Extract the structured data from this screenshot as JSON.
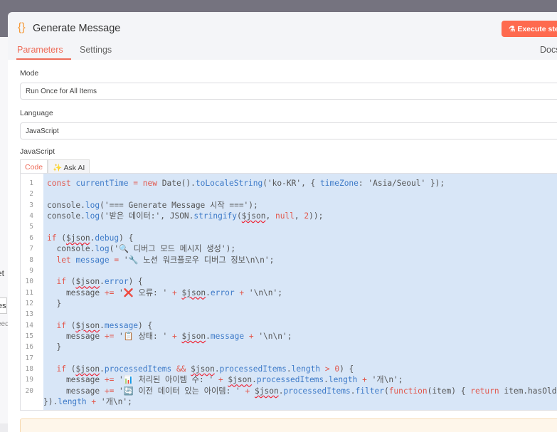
{
  "background_fragments": {
    "a": "et",
    "b": "es",
    "c": "eed"
  },
  "header": {
    "icon": "curly-braces-icon",
    "title": "Generate Message",
    "execute_label": "Execute step",
    "execute_icon": "flask-icon",
    "docs_label": "Docs"
  },
  "tabs": [
    {
      "label": "Parameters",
      "active": true
    },
    {
      "label": "Settings",
      "active": false
    }
  ],
  "fields": {
    "mode": {
      "label": "Mode",
      "value": "Run Once for All Items"
    },
    "language": {
      "label": "Language",
      "value": "JavaScript"
    },
    "code_label": "JavaScript"
  },
  "code_tabs": [
    {
      "label": "Code",
      "active": true
    },
    {
      "label": "Ask AI",
      "icon": "sparkle-icon"
    }
  ],
  "colors": {
    "accent": "#fe6a4f",
    "keyword": "#e2574c",
    "identifier": "#3d7ac8",
    "selection": "#d8e6f7"
  },
  "code_lines": [
    {
      "n": "1",
      "t": [
        [
          "k",
          "const"
        ],
        [
          "p",
          " "
        ],
        [
          "v",
          "currentTime"
        ],
        [
          "p",
          " "
        ],
        [
          "k",
          "="
        ],
        [
          "p",
          " "
        ],
        [
          "k",
          "new"
        ],
        [
          "p",
          " Date()."
        ],
        [
          "v",
          "toLocaleString"
        ],
        [
          "p",
          "('ko-KR', { "
        ],
        [
          "v",
          "timeZone"
        ],
        [
          "p",
          ": 'Asia/Seoul' });"
        ]
      ]
    },
    {
      "n": "2",
      "t": []
    },
    {
      "n": "3",
      "t": [
        [
          "p",
          "console."
        ],
        [
          "v",
          "log"
        ],
        [
          "p",
          "('=== Generate Message 시작 ===');"
        ]
      ]
    },
    {
      "n": "4",
      "t": [
        [
          "p",
          "console."
        ],
        [
          "v",
          "log"
        ],
        [
          "p",
          "('받은 데이터:', JSON."
        ],
        [
          "v",
          "stringify"
        ],
        [
          "p",
          "("
        ],
        [
          "u",
          "$json"
        ],
        [
          "p",
          ", "
        ],
        [
          "k",
          "null"
        ],
        [
          "p",
          ", "
        ],
        [
          "k",
          "2"
        ],
        [
          "p",
          "));"
        ]
      ]
    },
    {
      "n": "5",
      "t": []
    },
    {
      "n": "6",
      "t": [
        [
          "k",
          "if"
        ],
        [
          "p",
          " ("
        ],
        [
          "u",
          "$json"
        ],
        [
          "p",
          "."
        ],
        [
          "v",
          "debug"
        ],
        [
          "p",
          ") {"
        ]
      ]
    },
    {
      "n": "7",
      "t": [
        [
          "p",
          "  console."
        ],
        [
          "v",
          "log"
        ],
        [
          "p",
          "('🔍 디버그 모드 메시지 생성');"
        ]
      ]
    },
    {
      "n": "8",
      "t": [
        [
          "p",
          "  "
        ],
        [
          "k",
          "let"
        ],
        [
          "p",
          " "
        ],
        [
          "v",
          "message"
        ],
        [
          "p",
          " "
        ],
        [
          "k",
          "="
        ],
        [
          "p",
          " '🔧 노션 워크플로우 디버그 정보\\n\\n';"
        ]
      ]
    },
    {
      "n": "9",
      "t": []
    },
    {
      "n": "10",
      "t": [
        [
          "p",
          "  "
        ],
        [
          "k",
          "if"
        ],
        [
          "p",
          " ("
        ],
        [
          "u",
          "$json"
        ],
        [
          "p",
          "."
        ],
        [
          "v",
          "error"
        ],
        [
          "p",
          ") {"
        ]
      ]
    },
    {
      "n": "11",
      "t": [
        [
          "p",
          "    message "
        ],
        [
          "k",
          "+="
        ],
        [
          "p",
          " '❌ 오류: ' "
        ],
        [
          "k",
          "+"
        ],
        [
          "p",
          " "
        ],
        [
          "u",
          "$json"
        ],
        [
          "p",
          "."
        ],
        [
          "v",
          "error"
        ],
        [
          "p",
          " "
        ],
        [
          "k",
          "+"
        ],
        [
          "p",
          " '\\n\\n';"
        ]
      ]
    },
    {
      "n": "12",
      "t": [
        [
          "p",
          "  }"
        ]
      ]
    },
    {
      "n": "13",
      "t": []
    },
    {
      "n": "14",
      "t": [
        [
          "p",
          "  "
        ],
        [
          "k",
          "if"
        ],
        [
          "p",
          " ("
        ],
        [
          "u",
          "$json"
        ],
        [
          "p",
          "."
        ],
        [
          "v",
          "message"
        ],
        [
          "p",
          ") {"
        ]
      ]
    },
    {
      "n": "15",
      "t": [
        [
          "p",
          "    message "
        ],
        [
          "k",
          "+="
        ],
        [
          "p",
          " '📋 상태: ' "
        ],
        [
          "k",
          "+"
        ],
        [
          "p",
          " "
        ],
        [
          "u",
          "$json"
        ],
        [
          "p",
          "."
        ],
        [
          "v",
          "message"
        ],
        [
          "p",
          " "
        ],
        [
          "k",
          "+"
        ],
        [
          "p",
          " '\\n\\n';"
        ]
      ]
    },
    {
      "n": "16",
      "t": [
        [
          "p",
          "  }"
        ]
      ]
    },
    {
      "n": "17",
      "t": []
    },
    {
      "n": "18",
      "t": [
        [
          "p",
          "  "
        ],
        [
          "k",
          "if"
        ],
        [
          "p",
          " ("
        ],
        [
          "u",
          "$json"
        ],
        [
          "p",
          "."
        ],
        [
          "v",
          "processedItems"
        ],
        [
          "p",
          " "
        ],
        [
          "k",
          "&&"
        ],
        [
          "p",
          " "
        ],
        [
          "u",
          "$json"
        ],
        [
          "p",
          "."
        ],
        [
          "v",
          "processedItems"
        ],
        [
          "p",
          "."
        ],
        [
          "v",
          "length"
        ],
        [
          "p",
          " "
        ],
        [
          "k",
          ">"
        ],
        [
          "p",
          " "
        ],
        [
          "k",
          "0"
        ],
        [
          "p",
          ") {"
        ]
      ]
    },
    {
      "n": "19",
      "t": [
        [
          "p",
          "    message "
        ],
        [
          "k",
          "+="
        ],
        [
          "p",
          " '📊 처리된 아이템 수: ' "
        ],
        [
          "k",
          "+"
        ],
        [
          "p",
          " "
        ],
        [
          "u",
          "$json"
        ],
        [
          "p",
          "."
        ],
        [
          "v",
          "processedItems"
        ],
        [
          "p",
          "."
        ],
        [
          "v",
          "length"
        ],
        [
          "p",
          " "
        ],
        [
          "k",
          "+"
        ],
        [
          "p",
          " '개\\n';"
        ]
      ]
    },
    {
      "n": "20",
      "t": [
        [
          "p",
          "    message "
        ],
        [
          "k",
          "+="
        ],
        [
          "p",
          " '🔄 이전 데이터 있는 아이템: ' "
        ],
        [
          "k",
          "+"
        ],
        [
          "p",
          " "
        ],
        [
          "u",
          "$json"
        ],
        [
          "p",
          "."
        ],
        [
          "v",
          "processedItems"
        ],
        [
          "p",
          "."
        ],
        [
          "v",
          "filter"
        ],
        [
          "p",
          "("
        ],
        [
          "k",
          "function"
        ],
        [
          "p",
          "(item) { "
        ],
        [
          "k",
          "return"
        ],
        [
          "p",
          " item.hasOldData;"
        ]
      ]
    },
    {
      "n": "",
      "wrap": true,
      "t": [
        [
          "p",
          "})."
        ],
        [
          "v",
          "length"
        ],
        [
          "p",
          " "
        ],
        [
          "k",
          "+"
        ],
        [
          "p",
          " '개\\n';"
        ]
      ]
    }
  ]
}
